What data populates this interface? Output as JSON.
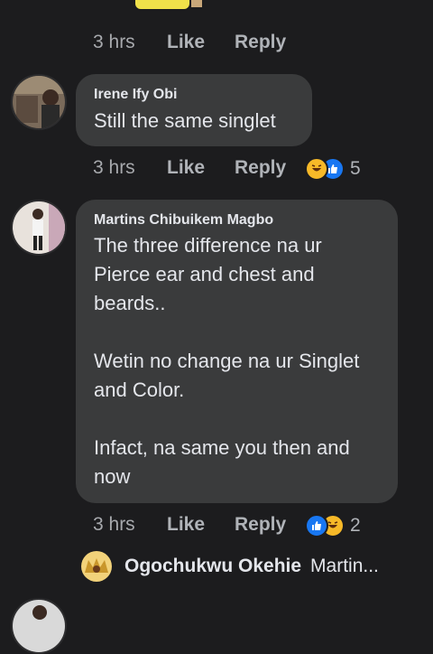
{
  "top_meta": {
    "time": "3 hrs",
    "like": "Like",
    "reply": "Reply"
  },
  "comments": [
    {
      "author": "Irene Ify Obi",
      "text": "Still the same singlet",
      "time": "3 hrs",
      "like": "Like",
      "reply": "Reply",
      "reaction_count": "5"
    },
    {
      "author": "Martins Chibuikem Magbo",
      "text": "The three difference na ur\nPierce ear and chest and\nbeards..\n\nWetin no change na ur Singlet\nand Color.\n\nInfact, na same you then and\nnow",
      "time": "3 hrs",
      "like": "Like",
      "reply": "Reply",
      "reaction_count": "2"
    }
  ],
  "reply_preview": {
    "author": "Ogochukwu Okehie",
    "snippet": "Martin..."
  },
  "colors": {
    "background": "#1c1c1e",
    "bubble": "#3a3b3c",
    "like_blue": "#1877f2",
    "haha_yellow": "#f7b928"
  }
}
